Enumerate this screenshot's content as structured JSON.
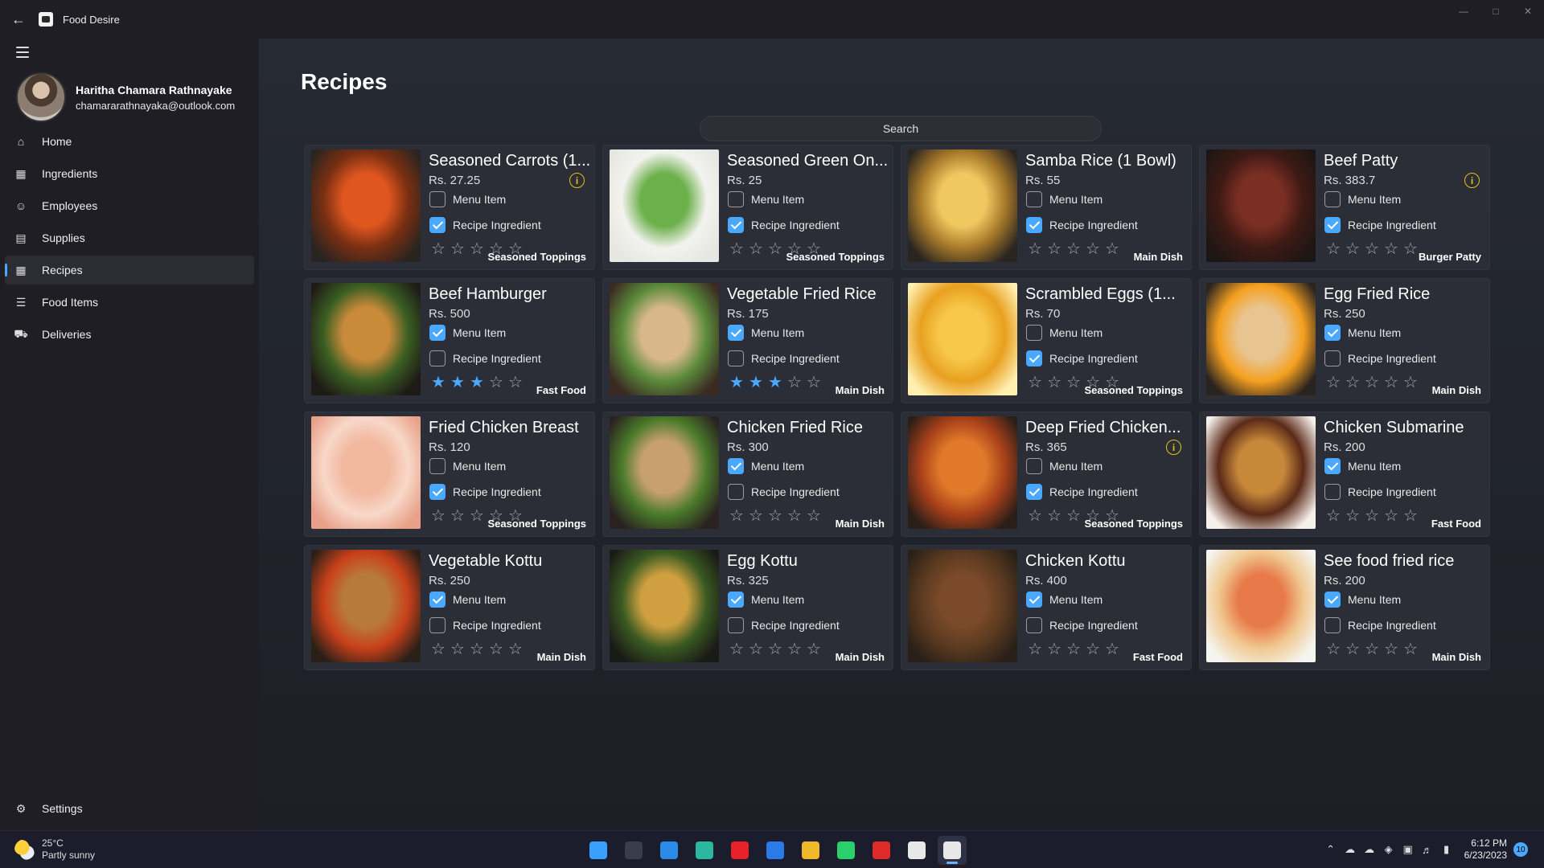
{
  "window": {
    "title": "Food Desire",
    "back_icon": "back-arrow-icon"
  },
  "profile": {
    "name": "Haritha Chamara Rathnayake",
    "email": "chamararathnayaka@outlook.com"
  },
  "nav": [
    {
      "label": "Home",
      "icon": "home-icon"
    },
    {
      "label": "Ingredients",
      "icon": "grid-icon"
    },
    {
      "label": "Employees",
      "icon": "people-icon"
    },
    {
      "label": "Supplies",
      "icon": "bag-icon"
    },
    {
      "label": "Recipes",
      "icon": "grid-icon",
      "active": true
    },
    {
      "label": "Food Items",
      "icon": "list-icon"
    },
    {
      "label": "Deliveries",
      "icon": "delivery-icon"
    }
  ],
  "settings_label": "Settings",
  "page_title": "Recipes",
  "search_placeholder": "Search",
  "checkbox_labels": {
    "menu_item": "Menu Item",
    "recipe_ingredient": "Recipe Ingredient"
  },
  "recipes": [
    {
      "name": "Seasoned Carrots (1...",
      "price": "Rs.  27.25",
      "menu_item": false,
      "recipe_ingredient": true,
      "rating": 0,
      "category": "Seasoned Toppings",
      "warning": true,
      "img": [
        "#e0561f",
        "#7a2f12",
        "#2a2420"
      ]
    },
    {
      "name": "Seasoned Green On...",
      "price": "Rs.  25",
      "menu_item": false,
      "recipe_ingredient": true,
      "rating": 0,
      "category": "Seasoned Toppings",
      "warning": false,
      "img": [
        "#6bb04a",
        "#f2f2ee",
        "#e6e6e2"
      ]
    },
    {
      "name": "Samba Rice (1 Bowl)",
      "price": "Rs.  55",
      "menu_item": false,
      "recipe_ingredient": true,
      "rating": 0,
      "category": "Main Dish",
      "warning": false,
      "img": [
        "#f0c860",
        "#a87a2a",
        "#2a2520"
      ]
    },
    {
      "name": "Beef Patty",
      "price": "Rs.  383.7",
      "menu_item": false,
      "recipe_ingredient": true,
      "rating": 0,
      "category": "Burger Patty",
      "warning": true,
      "img": [
        "#7a2e24",
        "#3e1a14",
        "#1e1614"
      ]
    },
    {
      "name": "Beef Hamburger",
      "price": "Rs.  500",
      "menu_item": true,
      "recipe_ingredient": false,
      "rating": 3,
      "category": "Fast Food",
      "warning": false,
      "img": [
        "#c98a3a",
        "#3a5e22",
        "#1e1a16"
      ]
    },
    {
      "name": "Vegetable Fried Rice",
      "price": "Rs.  175",
      "menu_item": true,
      "recipe_ingredient": false,
      "rating": 3,
      "category": "Main Dish",
      "warning": false,
      "img": [
        "#d8b88a",
        "#5a8a3a",
        "#3a2a22"
      ]
    },
    {
      "name": "Scrambled Eggs (1...",
      "price": "Rs.  70",
      "menu_item": false,
      "recipe_ingredient": true,
      "rating": 0,
      "category": "Seasoned Toppings",
      "warning": false,
      "img": [
        "#f7c84a",
        "#e8a020",
        "#fff0b0"
      ]
    },
    {
      "name": "Egg Fried Rice",
      "price": "Rs.  250",
      "menu_item": true,
      "recipe_ingredient": false,
      "rating": 0,
      "category": "Main Dish",
      "warning": false,
      "img": [
        "#e8c490",
        "#f5a020",
        "#2a2420"
      ]
    },
    {
      "name": "Fried Chicken Breast",
      "price": "Rs.  120",
      "menu_item": false,
      "recipe_ingredient": true,
      "rating": 0,
      "category": "Seasoned Toppings",
      "warning": false,
      "img": [
        "#f2b8a0",
        "#f8d8c8",
        "#e8a088"
      ]
    },
    {
      "name": "Chicken Fried Rice",
      "price": "Rs.  300",
      "menu_item": true,
      "recipe_ingredient": false,
      "rating": 0,
      "category": "Main Dish",
      "warning": false,
      "img": [
        "#c8a070",
        "#4a7a2a",
        "#2a2220"
      ]
    },
    {
      "name": "Deep Fried Chicken...",
      "price": "Rs.  365",
      "menu_item": false,
      "recipe_ingredient": true,
      "rating": 0,
      "category": "Seasoned Toppings",
      "warning": true,
      "img": [
        "#e07a2a",
        "#a8401a",
        "#2a1e18"
      ]
    },
    {
      "name": "Chicken Submarine",
      "price": "Rs.  200",
      "menu_item": true,
      "recipe_ingredient": false,
      "rating": 0,
      "category": "Fast Food",
      "warning": false,
      "img": [
        "#c8883a",
        "#5a2a18",
        "#f5f0ea"
      ]
    },
    {
      "name": "Vegetable Kottu",
      "price": "Rs.  250",
      "menu_item": true,
      "recipe_ingredient": false,
      "rating": 0,
      "category": "Main Dish",
      "warning": false,
      "img": [
        "#b87a3a",
        "#c8401a",
        "#2a2018"
      ]
    },
    {
      "name": "Egg Kottu",
      "price": "Rs.  325",
      "menu_item": true,
      "recipe_ingredient": false,
      "rating": 0,
      "category": "Main Dish",
      "warning": false,
      "img": [
        "#d0a040",
        "#3a5a22",
        "#1a1a16"
      ]
    },
    {
      "name": "Chicken Kottu",
      "price": "Rs.  400",
      "menu_item": true,
      "recipe_ingredient": false,
      "rating": 0,
      "category": "Fast Food",
      "warning": false,
      "img": [
        "#7a4a2a",
        "#5a3a20",
        "#2a2018"
      ]
    },
    {
      "name": "See food fried rice",
      "price": "Rs.  200",
      "menu_item": true,
      "recipe_ingredient": false,
      "rating": 0,
      "category": "Main Dish",
      "warning": false,
      "img": [
        "#e87a4a",
        "#f0c890",
        "#f5f5f0"
      ]
    }
  ],
  "taskbar": {
    "weather_temp": "25°C",
    "weather_desc": "Partly sunny",
    "apps": [
      {
        "name": "windows-start-icon",
        "color": "#3aa0ff"
      },
      {
        "name": "terminal-icon",
        "color": "#3a3e4a"
      },
      {
        "name": "mail-icon",
        "color": "#2a8ae8"
      },
      {
        "name": "edge-dev-icon",
        "color": "#2ab8a0"
      },
      {
        "name": "opera-icon",
        "color": "#e8202a"
      },
      {
        "name": "chat-icon",
        "color": "#2a7ae8"
      },
      {
        "name": "file-explorer-icon",
        "color": "#f0b82a"
      },
      {
        "name": "whatsapp-icon",
        "color": "#2ad06a"
      },
      {
        "name": "todoist-icon",
        "color": "#e02a2a"
      },
      {
        "name": "package-icon",
        "color": "#e8e8e8"
      },
      {
        "name": "food-desire-app-icon",
        "color": "#e8e8e8",
        "active": true
      }
    ],
    "time": "6:12 PM",
    "date": "6/23/2023",
    "notifications": "10"
  }
}
